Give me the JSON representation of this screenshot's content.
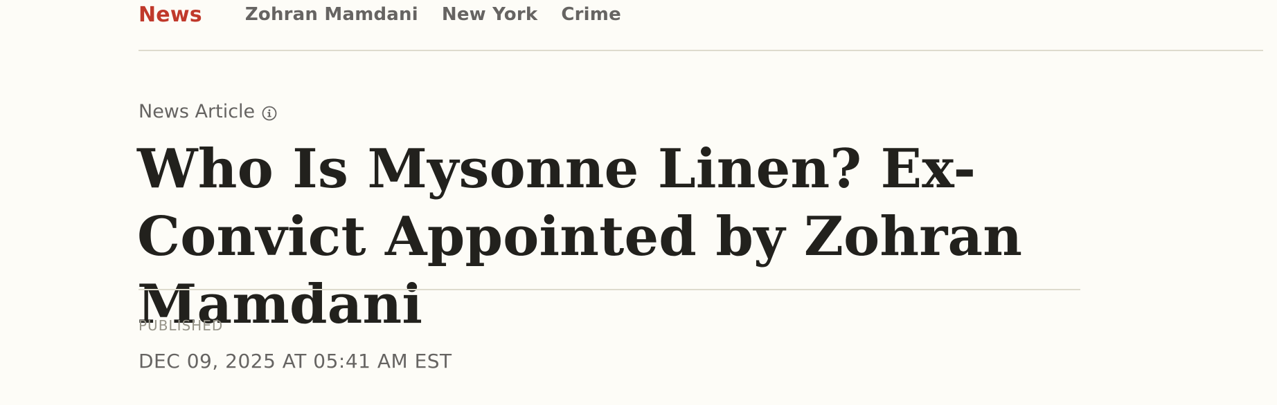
{
  "nav": {
    "section": "News",
    "topics": [
      "Zohran Mamdani",
      "New York",
      "Crime"
    ]
  },
  "article": {
    "type_label": "News Article",
    "info_icon": "info-circle-icon",
    "headline": "Who Is Mysonne Linen? Ex-Convict Appointed by Zohran Mamdani",
    "published_label": "PUBLISHED",
    "published_date": "DEC 09, 2025 AT 05:41 AM EST"
  },
  "colors": {
    "background": "#fdfcf7",
    "accent": "#c0392b",
    "text_primary": "#22211d",
    "text_secondary": "#666462",
    "text_muted": "#969388",
    "divider": "#dedbcd"
  }
}
